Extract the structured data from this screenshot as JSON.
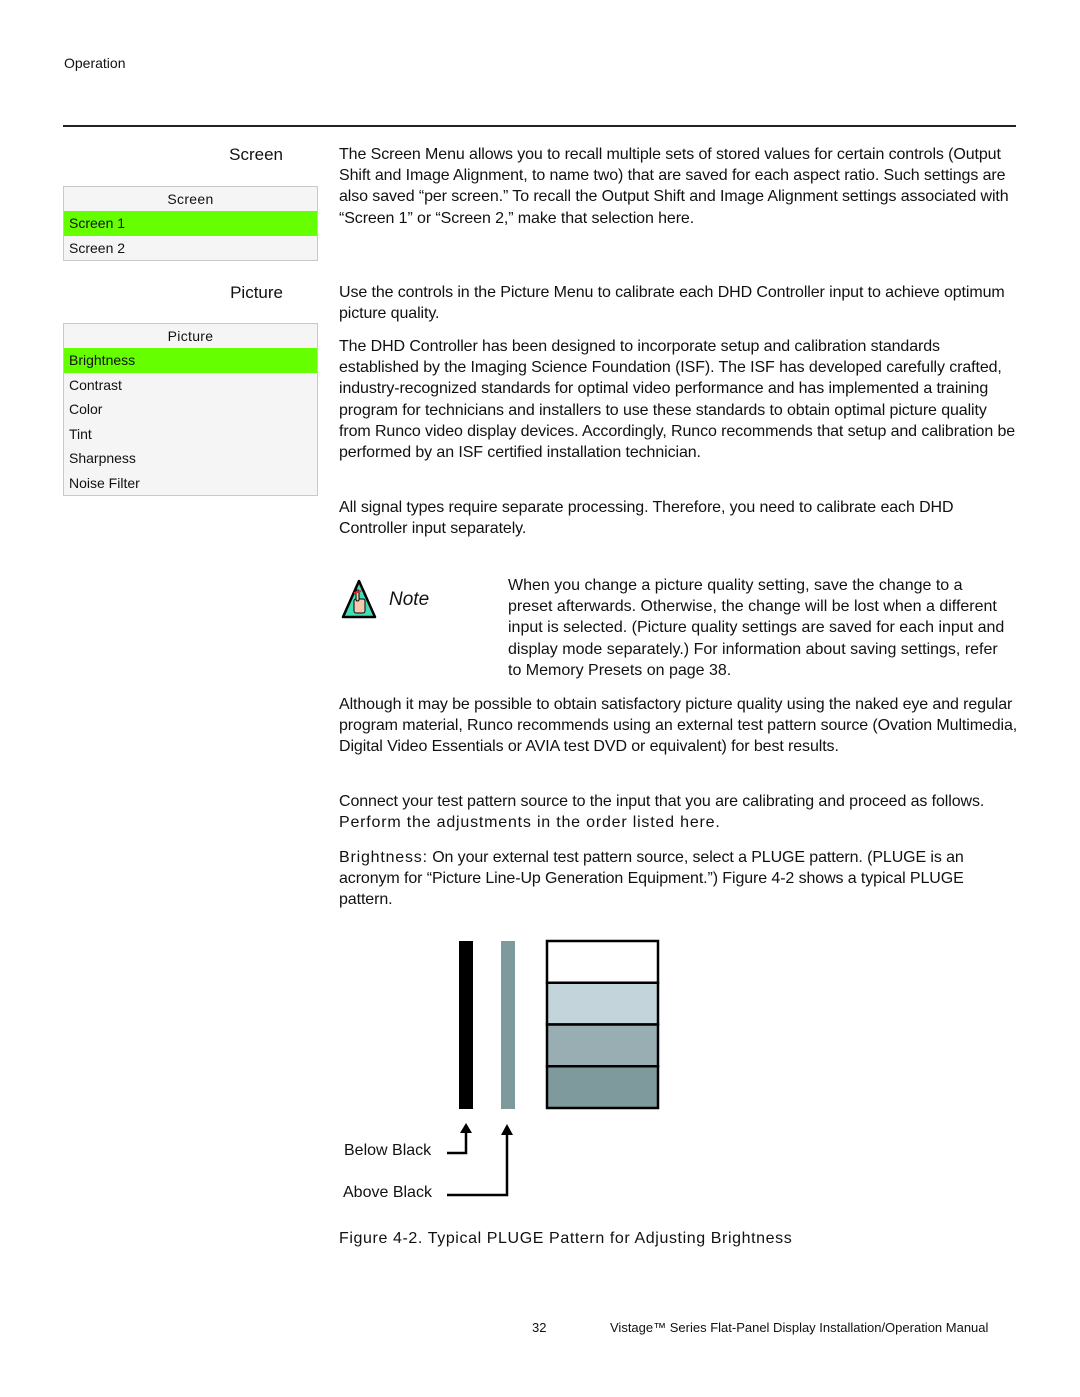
{
  "header": {
    "section": "Operation"
  },
  "screen_section": {
    "heading": "Screen",
    "menu": {
      "title": "Screen",
      "items": [
        {
          "label": "Screen 1",
          "selected": true
        },
        {
          "label": "Screen 2",
          "selected": false
        }
      ]
    },
    "paragraph": "The Screen Menu allows you to recall multiple sets of stored values for certain controls (Output Shift and Image Alignment, to name two) that are saved for each aspect ratio. Such settings are also saved “per screen.” To recall the Output Shift and Image Alignment settings associated with “Screen 1” or “Screen 2,” make that selection here."
  },
  "picture_section": {
    "heading": "Picture",
    "menu": {
      "title": "Picture",
      "items": [
        {
          "label": "Brightness",
          "selected": true
        },
        {
          "label": "Contrast",
          "selected": false
        },
        {
          "label": "Color",
          "selected": false
        },
        {
          "label": "Tint",
          "selected": false
        },
        {
          "label": "Sharpness",
          "selected": false
        },
        {
          "label": "Noise Filter",
          "selected": false
        }
      ]
    },
    "paragraphs": [
      "Use the controls in the Picture Menu to calibrate each DHD Controller input to achieve optimum picture quality.",
      "The DHD Controller has been designed to incorporate setup and calibration standards established by the Imaging Science Foundation (ISF). The ISF has developed carefully crafted, industry-recognized standards for optimal video performance and has implemented a training program for technicians and installers to use these standards to obtain optimal picture quality from Runco video display devices. Accordingly, Runco recommends that setup and calibration be performed by an ISF certified installation technician.",
      "All signal types require separate processing. Therefore, you need to calibrate each DHD Controller input separately."
    ],
    "note": {
      "label": "Note",
      "icon": "pointing-hand-warning-icon",
      "text": "When you change a picture quality setting, save the change to a preset afterwards. Otherwise, the change will be lost when a different input is selected. (Picture quality settings are saved for each input and display mode separately.) For information about saving settings, refer to Memory Presets   on page 38."
    },
    "paragraphs_after_note": [
      "Although it may be possible to obtain satisfactory picture quality using the naked eye and regular program material, Runco recommends using an external test pattern source (Ovation Multimedia, Digital Video Essentials or AVIA test DVD or equivalent) for best results."
    ],
    "connect_para": {
      "part1": "Connect your test pattern source to the input that you are calibrating and proceed as follows. ",
      "part2": "Perform the adjustments in the order listed here."
    },
    "brightness_para": {
      "term": "Brightness:",
      "text": " On your external test pattern source, select a PLUGE pattern. (PLUGE is an acronym for “Picture Line-Up Generation Equipment.”) Figure 4-2 shows a typical PLUGE pattern."
    }
  },
  "figure": {
    "labels": {
      "below_black": "Below Black",
      "above_black": "Above Black"
    },
    "colors": {
      "below_black_bar": "#000000",
      "above_black_bar": "#7e9a9c",
      "steps": [
        "#ffffff",
        "#c3d5da",
        "#98aeb3",
        "#7e9a9c"
      ]
    },
    "caption": "Figure 4-2. Typical PLUGE Pattern for Adjusting Brightness"
  },
  "footer": {
    "page_number": "32",
    "manual_title": "Vistage™ Series Flat-Panel Display Installation/Operation Manual"
  }
}
